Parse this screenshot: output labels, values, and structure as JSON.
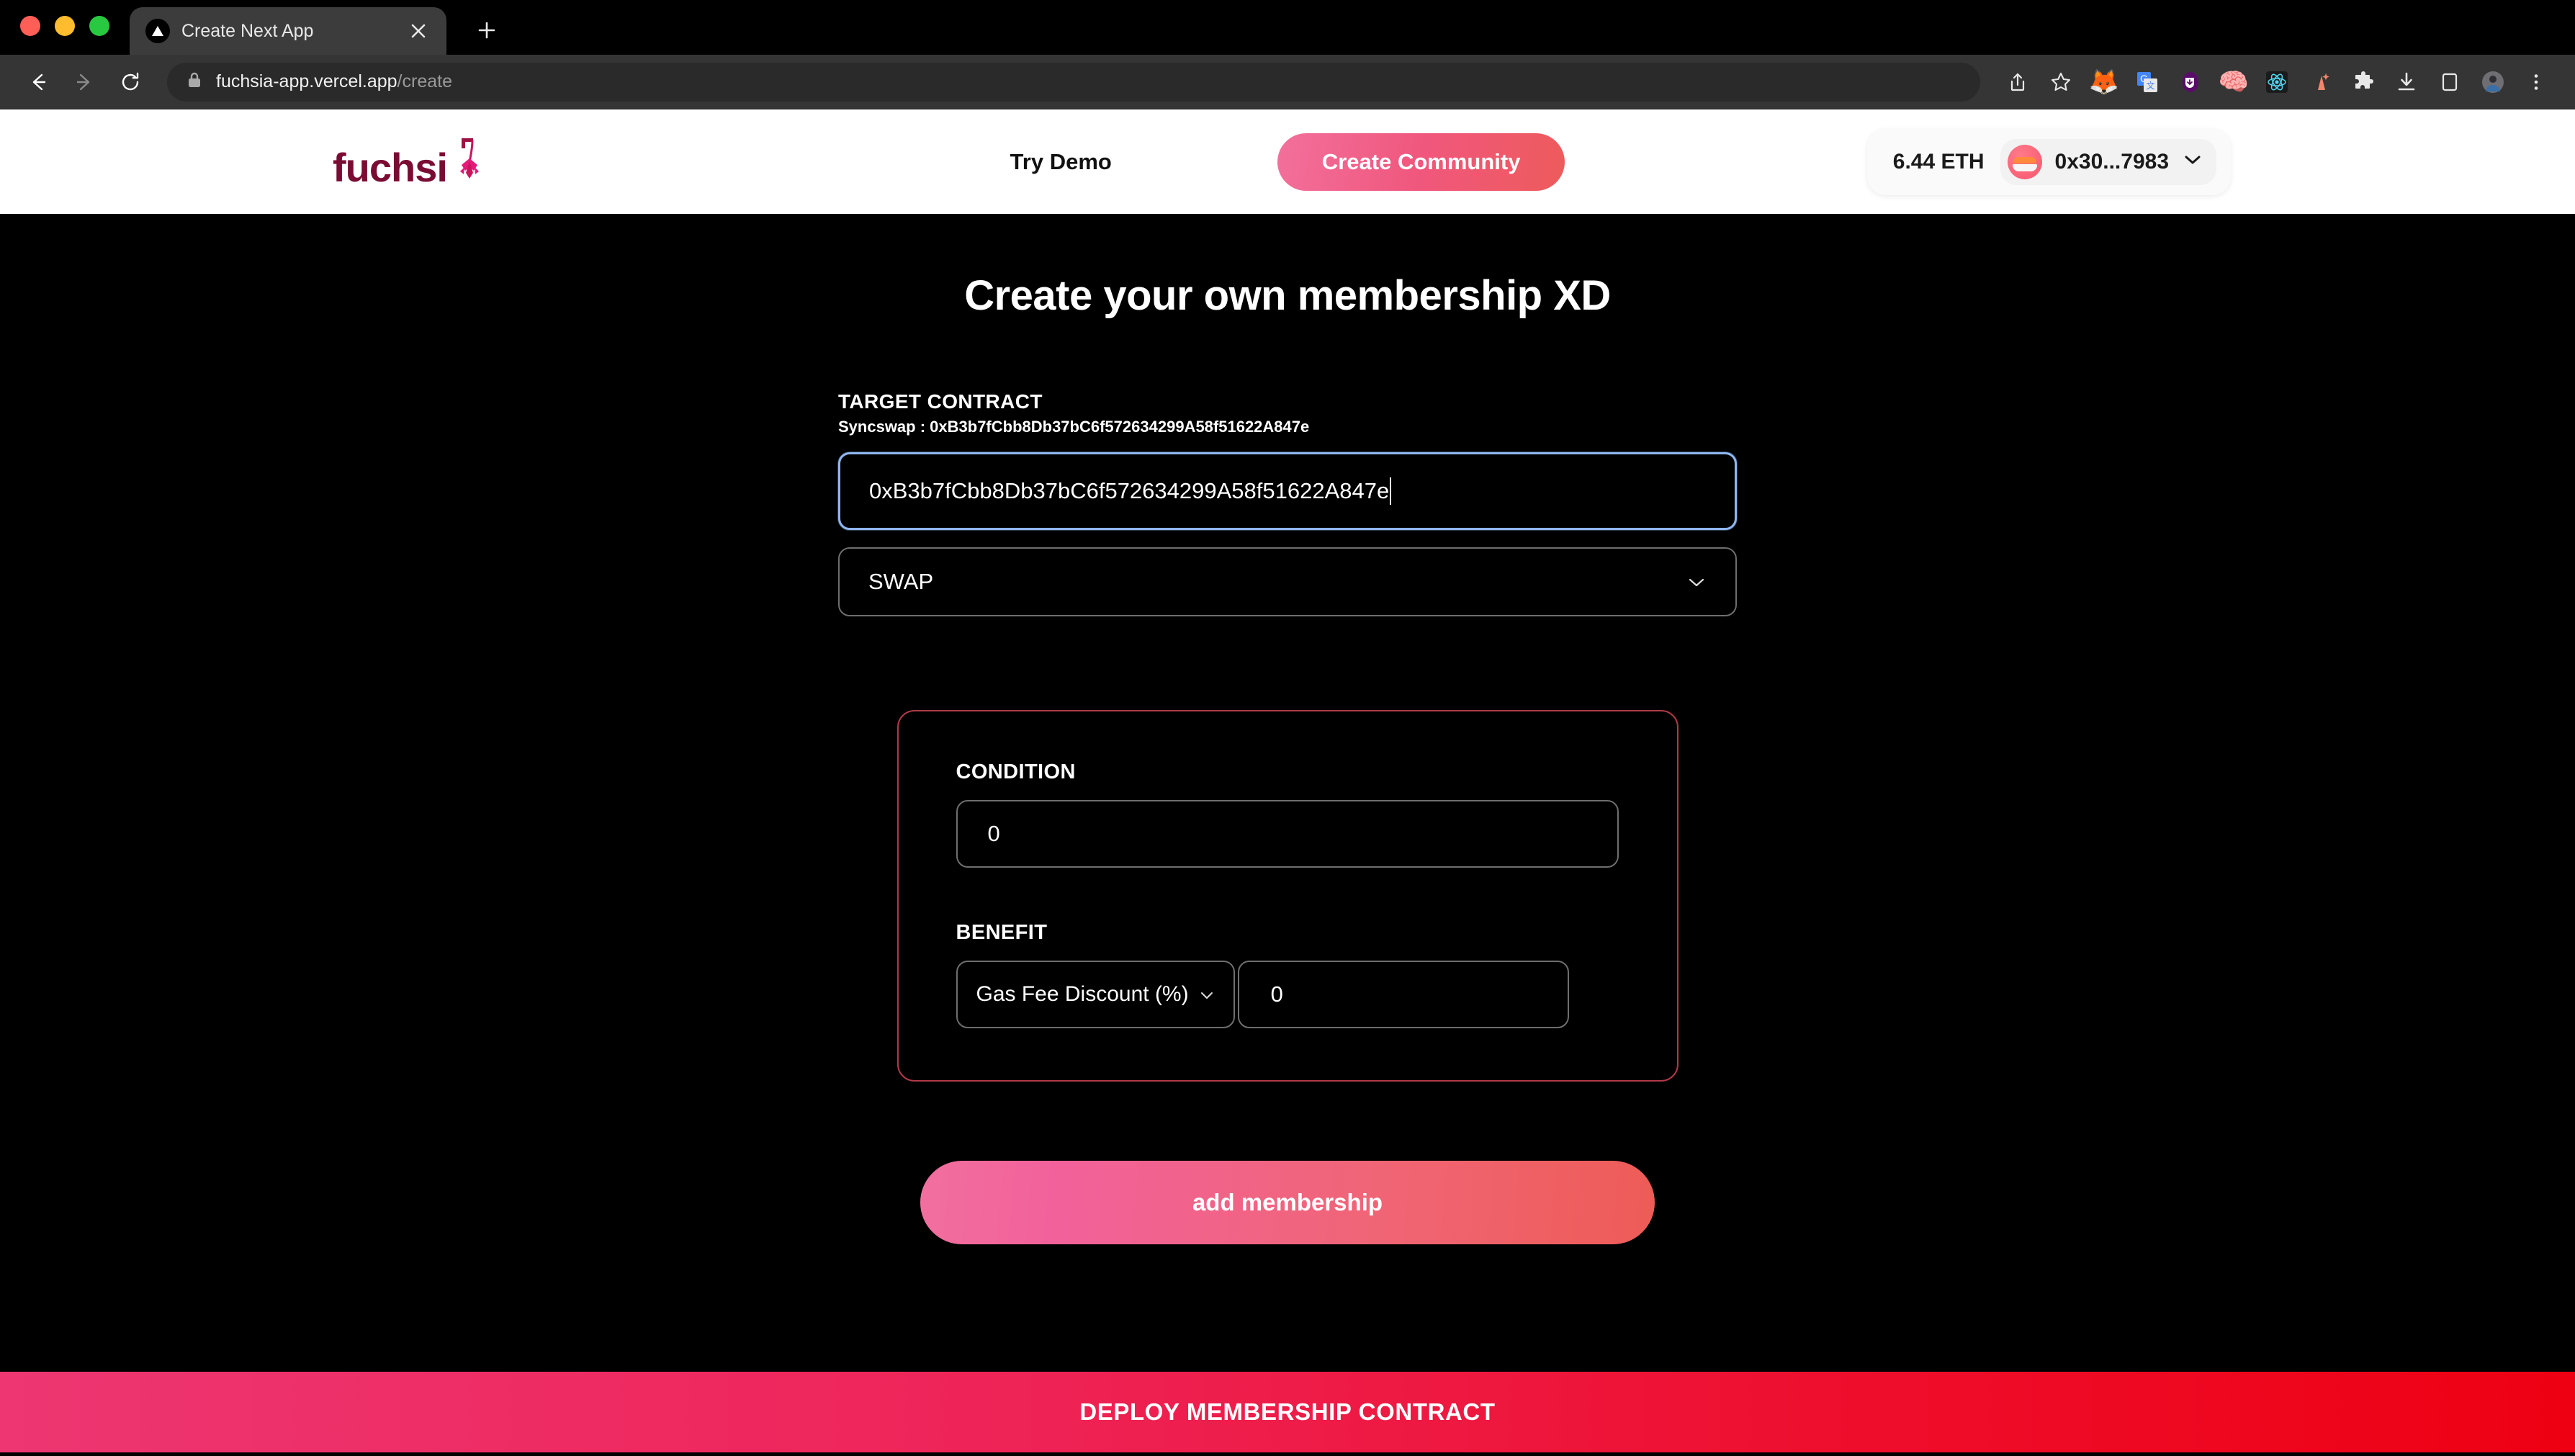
{
  "browser": {
    "window_controls": [
      "close",
      "minimize",
      "maximize"
    ],
    "tab": {
      "title": "Create Next App",
      "favicon": "nextjs-triangle-icon",
      "close_icon": "close-icon"
    },
    "new_tab_label": "+",
    "nav": {
      "back": "back-arrow-icon",
      "forward": "forward-arrow-icon",
      "reload": "reload-icon"
    },
    "url": {
      "lock": "lock-icon",
      "domain": "fuchsia-app.vercel.app",
      "path": "/create"
    },
    "toolbar_icons": [
      "share-icon",
      "bookmark-star-icon",
      "metamask-extension-icon",
      "google-translate-extension-icon",
      "phantom-wallet-extension-icon",
      "brain-extension-icon",
      "react-devtools-extension-icon",
      "ai-sparkle-extension-icon",
      "puzzle-extensions-icon",
      "downloads-icon",
      "sidepanel-icon",
      "profile-avatar-icon",
      "chrome-menu-icon"
    ]
  },
  "header": {
    "logo_text": "fuchsi",
    "logo_flower": "fuchsia-flower-icon",
    "try_demo": "Try Demo",
    "create_community": "Create Community",
    "wallet": {
      "balance": "6.44 ETH",
      "address": "0x30...7983",
      "avatar": "wallet-avatar-icon",
      "chevron": "chevron-down-icon"
    }
  },
  "main": {
    "title": "Create your own membership XD",
    "target_contract": {
      "label": "TARGET CONTRACT",
      "hint": "Syncswap : 0xB3b7fCbb8Db37bC6f572634299A58f51622A847e",
      "value": "0xB3b7fCbb8Db37bC6f572634299A58f51622A847e",
      "placeholder": "0x..."
    },
    "action_select": {
      "value": "SWAP",
      "chevron": "chevron-down-icon",
      "options": [
        "SWAP"
      ]
    },
    "rule_card": {
      "condition": {
        "label": "CONDITION",
        "value": "0",
        "placeholder": "0"
      },
      "benefit": {
        "label": "BENEFIT",
        "type_value": "Gas Fee Discount (%)",
        "type_chevron": "chevron-down-icon",
        "type_options": [
          "Gas Fee Discount (%)"
        ],
        "amount_value": "0",
        "amount_placeholder": "0"
      }
    },
    "add_membership": "add membership",
    "deploy": "DEPLOY MEMBERSHIP CONTRACT"
  },
  "colors": {
    "accent_pink": "#ED3672",
    "accent_red": "#EE0012",
    "logo_maroon": "#7A0C33",
    "card_border": "#B03A48",
    "focus_blue": "#8FB6F0",
    "page_bg": "#000000"
  }
}
